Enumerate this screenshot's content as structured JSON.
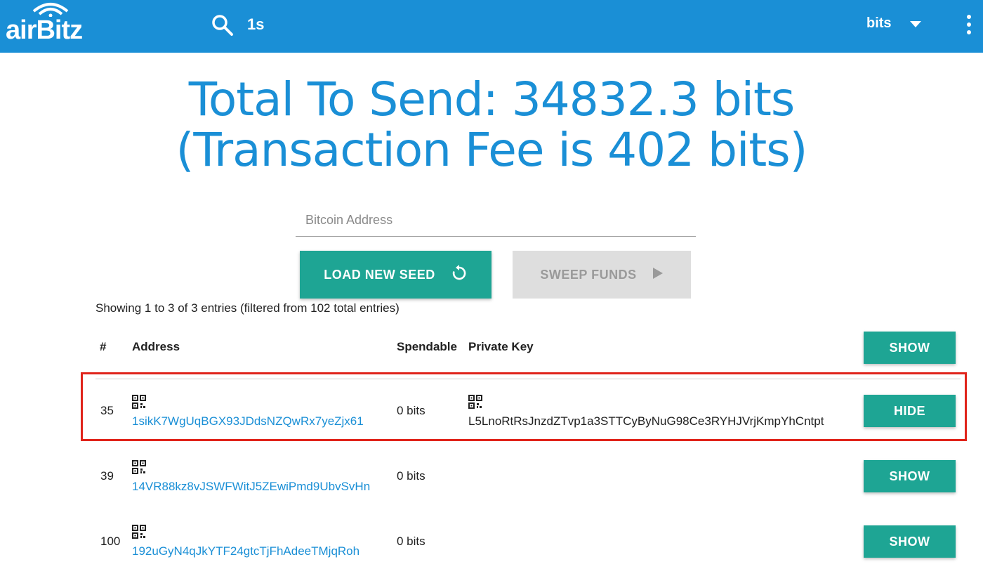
{
  "header": {
    "logo_text": "airBitz",
    "search_query": "1s",
    "unit": "bits"
  },
  "colors": {
    "header_bg": "#1a8fd6",
    "accent_teal": "#1ea594",
    "link_blue": "#1a8fd6",
    "highlight_red": "#e0241b"
  },
  "summary": {
    "total_line": "Total To Send: 34832.3 bits",
    "fee_line": "(Transaction Fee is 402 bits)"
  },
  "form": {
    "address_placeholder": "Bitcoin Address",
    "address_value": "",
    "load_seed_label": "LOAD NEW SEED",
    "sweep_label": "SWEEP FUNDS"
  },
  "table": {
    "info": "Showing 1 to 3 of 3 entries (filtered from 102 total entries)",
    "columns": [
      "#",
      "Address",
      "Spendable",
      "Private Key"
    ],
    "header_button": "SHOW",
    "rows": [
      {
        "num": "35",
        "address": "1sikK7WgUqBGX93JDdsNZQwRx7yeZjx61",
        "spendable": "0 bits",
        "private_key": "L5LnoRtRsJnzdZTvp1a3STTCyByNuG98Ce3RYHJVrjKmpYhCntpt",
        "button": "HIDE",
        "highlighted": true
      },
      {
        "num": "39",
        "address": "14VR88kz8vJSWFWitJ5ZEwiPmd9UbvSvHn",
        "spendable": "0 bits",
        "private_key": "",
        "button": "SHOW",
        "highlighted": false
      },
      {
        "num": "100",
        "address": "192uGyN4qJkYTF24gtcTjFhAdeeTMjqRoh",
        "spendable": "0 bits",
        "private_key": "",
        "button": "SHOW",
        "highlighted": false
      }
    ]
  }
}
